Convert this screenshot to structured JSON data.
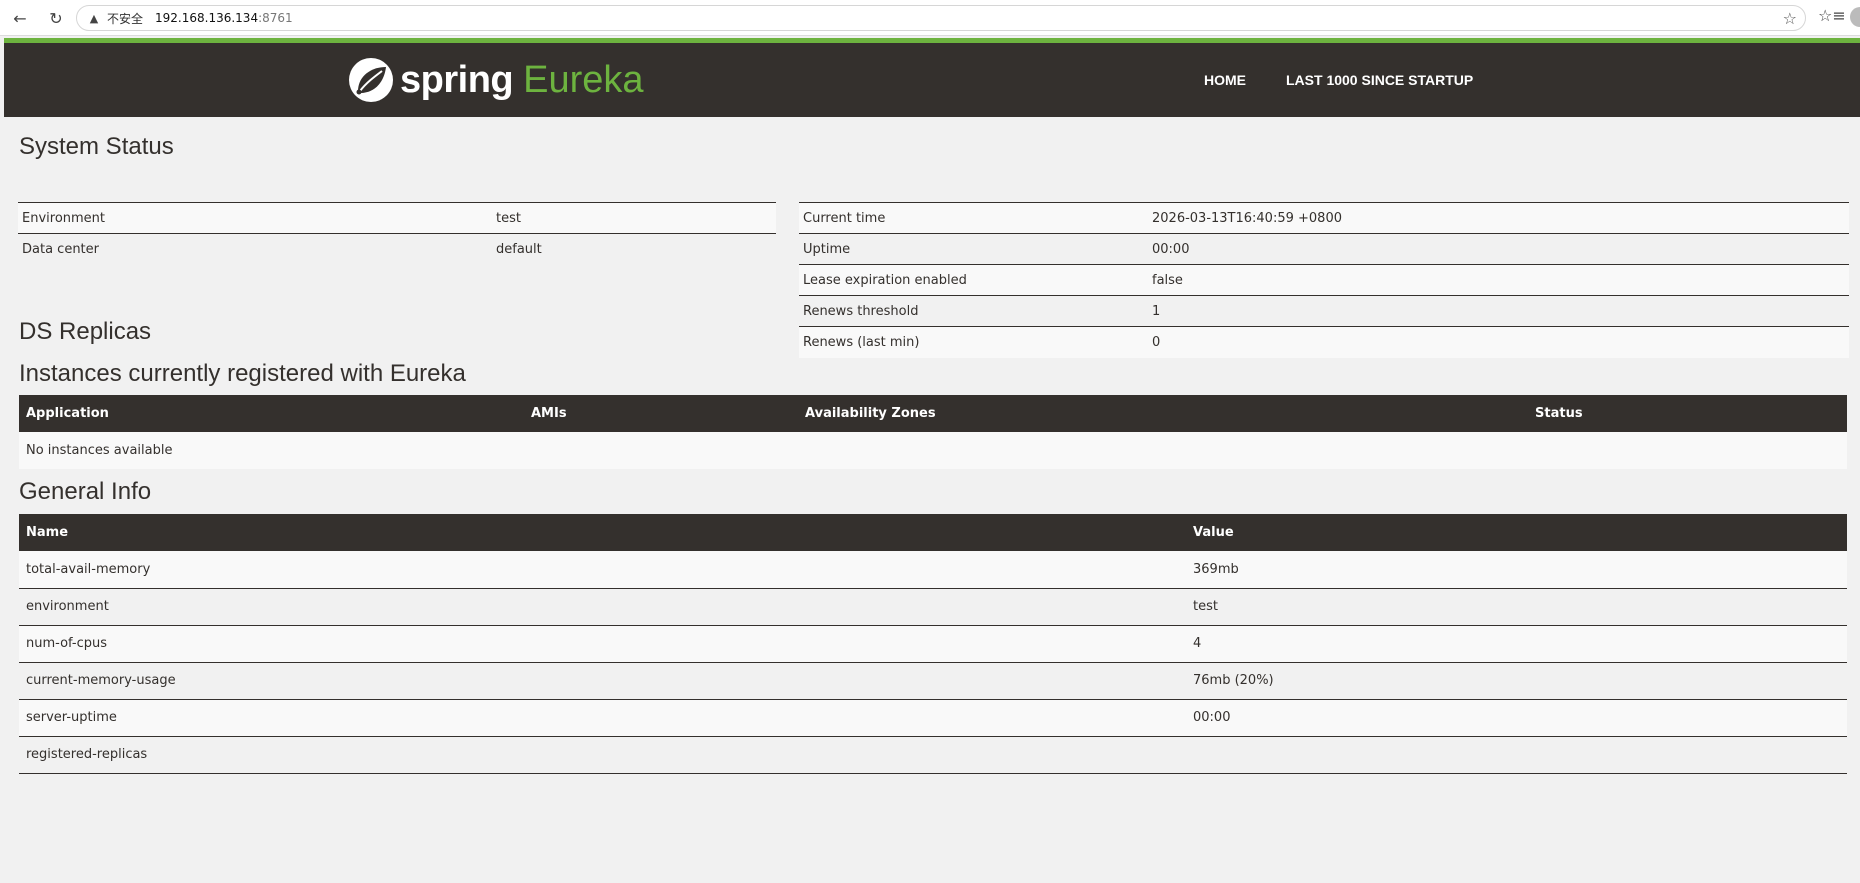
{
  "browser": {
    "insecure_label": "不安全",
    "url_host": "192.168.136.134",
    "url_port": ":8761"
  },
  "navbar": {
    "brand_spring": "spring",
    "brand_eureka": "Eureka",
    "links": [
      "HOME",
      "LAST 1000 SINCE STARTUP"
    ]
  },
  "system_status": {
    "title": "System Status",
    "left": [
      {
        "label": "Environment",
        "value": "test"
      },
      {
        "label": "Data center",
        "value": "default"
      }
    ],
    "right": [
      {
        "label": "Current time",
        "value": "2026-03-13T16:40:59 +0800"
      },
      {
        "label": "Uptime",
        "value": "00:00"
      },
      {
        "label": "Lease expiration enabled",
        "value": "false"
      },
      {
        "label": "Renews threshold",
        "value": "1"
      },
      {
        "label": "Renews (last min)",
        "value": "0"
      }
    ]
  },
  "ds_replicas": {
    "title": "DS Replicas"
  },
  "instances": {
    "title": "Instances currently registered with Eureka",
    "headers": [
      "Application",
      "AMIs",
      "Availability Zones",
      "Status"
    ],
    "empty_message": "No instances available"
  },
  "general_info": {
    "title": "General Info",
    "headers": [
      "Name",
      "Value"
    ],
    "rows": [
      {
        "name": "total-avail-memory",
        "value": "369mb"
      },
      {
        "name": "environment",
        "value": "test"
      },
      {
        "name": "num-of-cpus",
        "value": "4"
      },
      {
        "name": "current-memory-usage",
        "value": "76mb (20%)"
      },
      {
        "name": "server-uptime",
        "value": "00:00"
      },
      {
        "name": "registered-replicas",
        "value": ""
      }
    ]
  }
}
